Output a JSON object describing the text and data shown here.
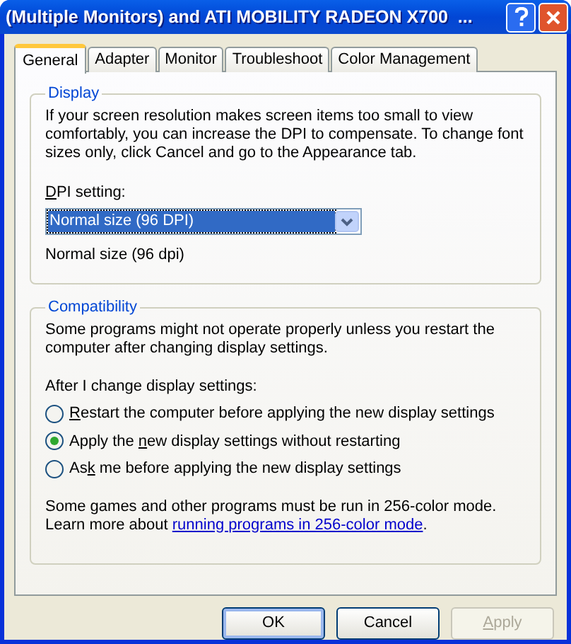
{
  "window": {
    "title": "(Multiple Monitors) and ATI MOBILITY RADEON X700  ..."
  },
  "tabs": [
    {
      "label": "General",
      "selected": true
    },
    {
      "label": "Adapter",
      "selected": false
    },
    {
      "label": "Monitor",
      "selected": false
    },
    {
      "label": "Troubleshoot",
      "selected": false
    },
    {
      "label": "Color Management",
      "selected": false
    }
  ],
  "display": {
    "title": "Display",
    "description": "If your screen resolution makes screen items too small to view comfortably, you can increase the DPI to compensate.  To change font sizes only, click Cancel and go to the Appearance tab.",
    "dpi_label": {
      "key": "D",
      "after": "PI setting:"
    },
    "dpi_select": {
      "value": "Normal size (96 DPI)",
      "focused": true
    },
    "dpi_note": "Normal size (96 dpi)"
  },
  "compatibility": {
    "title": "Compatibility",
    "description": "Some programs might not operate properly unless you restart the computer after changing display settings.",
    "prompt": "After I change display settings:",
    "options": [
      {
        "key": "R",
        "after": "estart the computer before applying the new display settings",
        "selected": false
      },
      {
        "before": "Apply the ",
        "key": "n",
        "after": "ew display settings without restarting",
        "selected": true
      },
      {
        "before": "As",
        "key": "k",
        "after": " me before applying the new display settings",
        "selected": false
      }
    ],
    "note": "Some games and other programs must be run in 256-color mode.",
    "learn_prefix": "Learn more about ",
    "learn_link": "running programs in 256-color mode",
    "learn_suffix": "."
  },
  "buttons": [
    {
      "before": "OK",
      "disabled": false,
      "default": true
    },
    {
      "before": "Cancel",
      "disabled": false,
      "default": false
    },
    {
      "key": "A",
      "after": "pply",
      "disabled": true,
      "default": false
    }
  ]
}
